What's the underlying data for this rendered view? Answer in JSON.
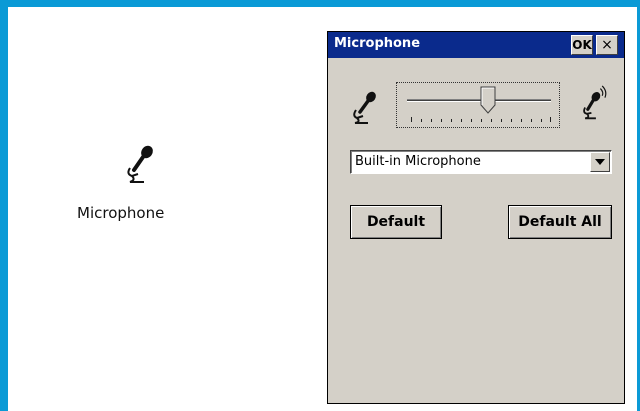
{
  "desktop": {
    "icon_name": "microphone-icon",
    "label": "Microphone"
  },
  "dialog": {
    "title": "Microphone",
    "ok_label": "OK",
    "close_label": "×",
    "slider": {
      "level": 0.56,
      "low_icon": "microphone-icon",
      "high_icon": "microphone-loud-icon"
    },
    "input_source": "Built-in Microphone",
    "default_label": "Default",
    "default_all_label": "Default All"
  },
  "colors": {
    "frame": "#0a9ad6",
    "titlebar": "#0a2a8c",
    "dialog_bg": "#d4d0c8"
  }
}
